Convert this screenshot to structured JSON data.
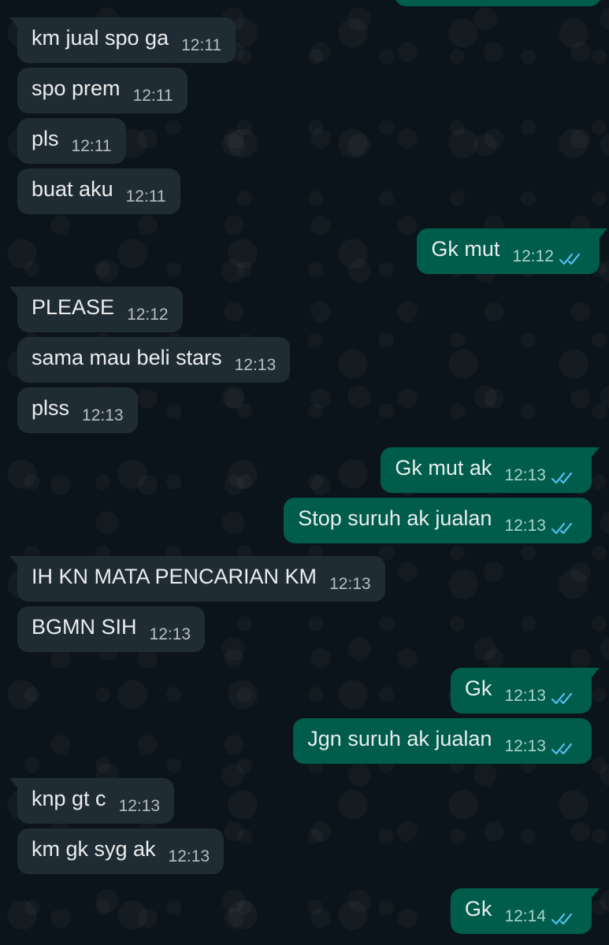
{
  "colors": {
    "background": "#0b141a",
    "incoming_bubble": "#202c33",
    "outgoing_bubble": "#005c4b",
    "read_ticks": "#53bdeb"
  },
  "messages": [
    {
      "dir": "in",
      "text": "km jual spo ga",
      "time": "12:11"
    },
    {
      "dir": "in",
      "text": "spo prem",
      "time": "12:11"
    },
    {
      "dir": "in",
      "text": "pls",
      "time": "12:11"
    },
    {
      "dir": "in",
      "text": "buat aku",
      "time": "12:11"
    },
    {
      "dir": "out",
      "text": "Gk mut",
      "time": "12:12",
      "status": "read-ticks-icon"
    },
    {
      "dir": "in",
      "text": "PLEASE",
      "time": "12:12"
    },
    {
      "dir": "in",
      "text": "sama mau beli stars",
      "time": "12:13"
    },
    {
      "dir": "in",
      "text": "plss",
      "time": "12:13"
    },
    {
      "dir": "out",
      "text": "Gk mut ak",
      "time": "12:13",
      "status": "read-ticks-icon"
    },
    {
      "dir": "out",
      "text": "Stop suruh ak jualan",
      "time": "12:13",
      "status": "read-ticks-icon"
    },
    {
      "dir": "in",
      "text": "IH KN MATA PENCARIAN KM",
      "time": "12:13"
    },
    {
      "dir": "in",
      "text": "BGMN SIH",
      "time": "12:13"
    },
    {
      "dir": "out",
      "text": "Gk",
      "time": "12:13",
      "status": "read-ticks-icon"
    },
    {
      "dir": "out",
      "text": "Jgn suruh ak jualan",
      "time": "12:13",
      "status": "read-ticks-icon"
    },
    {
      "dir": "in",
      "text": "knp gt c",
      "time": "12:13"
    },
    {
      "dir": "in",
      "text": "km gk syg ak",
      "time": "12:13"
    },
    {
      "dir": "out",
      "text": "Gk",
      "time": "12:14",
      "status": "read-ticks-icon"
    }
  ]
}
